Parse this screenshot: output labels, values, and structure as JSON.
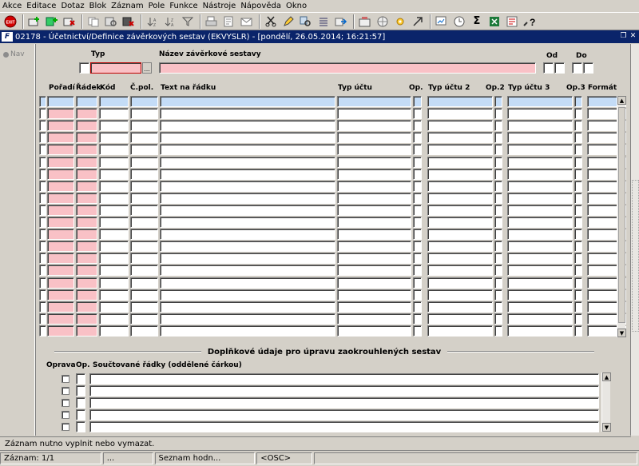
{
  "menu": [
    {
      "label": "Akce"
    },
    {
      "label": "Editace"
    },
    {
      "label": "Dotaz"
    },
    {
      "label": "Blok"
    },
    {
      "label": "Záznam"
    },
    {
      "label": "Pole"
    },
    {
      "label": "Funkce"
    },
    {
      "label": "Nástroje"
    },
    {
      "label": "Nápověda"
    },
    {
      "label": "Okno"
    }
  ],
  "toolbar": {
    "exit_label": "EXIT",
    "sigma": "Σ",
    "help": "?"
  },
  "window": {
    "title": "02178 - Účetnictví/Definice závěrkových sestav (EKVYSLR) - [pondělí, 26.05.2014; 16:21:57]",
    "icon_text": "F"
  },
  "nav": {
    "label": "Nav"
  },
  "header": {
    "typ_label": "Typ",
    "nazev_label": "Název závěrkové sestavy",
    "od_label": "Od",
    "do_label": "Do",
    "lov_label": "..."
  },
  "columns": {
    "poradi": "Pořadí",
    "radek": "Řádek",
    "kod": "Kód",
    "cpol": "Č.pol.",
    "text": "Text na řádku",
    "typ_uctu": "Typ účtu",
    "op": "Op.",
    "typ_uctu2": "Typ účtu 2",
    "op2": "Op.2",
    "typ_uctu3": "Typ účtu 3",
    "op3": "Op.3",
    "format": "Formát"
  },
  "section": {
    "title": "Doplňkové údaje pro úpravu zaokrouhlených sestav",
    "oprava_label": "Oprava",
    "op_label": "Op.",
    "soucet_label": "Součtované řádky (oddělené čárkou)"
  },
  "status": {
    "message": "Záznam nutno vyplnit nebo vymazat.",
    "record": "Záznam: 1/1",
    "cell2": "...",
    "list": "Seznam hodn...",
    "mode": "<OSC>"
  },
  "colors": {
    "required": "#f9c1c6",
    "current": "#c4dcf7",
    "title_bar": "#0a246a",
    "face": "#d4d0c8"
  }
}
